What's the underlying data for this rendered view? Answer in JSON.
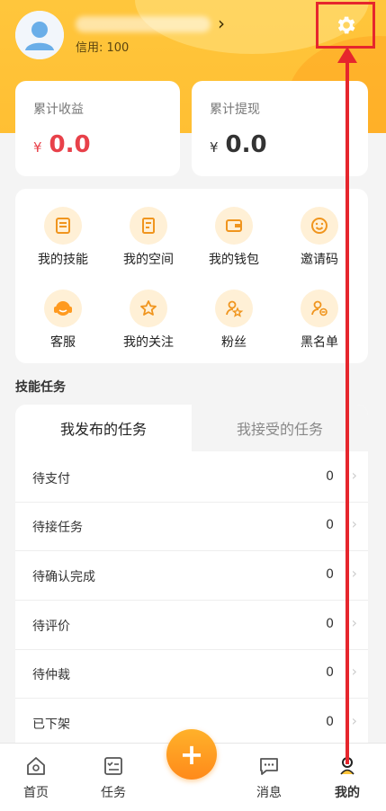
{
  "profile": {
    "credit_text": "信用: 100",
    "chevron": "›"
  },
  "settings": {
    "icon": "gear-icon"
  },
  "earnings": {
    "total_income_label": "累计收益",
    "total_income_currency": "¥",
    "total_income_value": "0.0",
    "total_withdraw_label": "累计提现",
    "total_withdraw_currency": "¥",
    "total_withdraw_value": "0.0",
    "income_color": "#e8414a",
    "withdraw_color": "#333333"
  },
  "shortcuts": [
    {
      "label": "我的技能",
      "icon": "skills-icon"
    },
    {
      "label": "我的空间",
      "icon": "space-icon"
    },
    {
      "label": "我的钱包",
      "icon": "wallet-icon"
    },
    {
      "label": "邀请码",
      "icon": "smile-icon"
    },
    {
      "label": "客服",
      "icon": "headset-icon"
    },
    {
      "label": "我的关注",
      "icon": "star-icon"
    },
    {
      "label": "粉丝",
      "icon": "fans-icon"
    },
    {
      "label": "黑名单",
      "icon": "blacklist-icon"
    }
  ],
  "tasks": {
    "section_title": "技能任务",
    "tab_published": "我发布的任务",
    "tab_accepted": "我接受的任务",
    "rows": [
      {
        "label": "待支付",
        "count": "0"
      },
      {
        "label": "待接任务",
        "count": "0"
      },
      {
        "label": "待确认完成",
        "count": "0"
      },
      {
        "label": "待评价",
        "count": "0"
      },
      {
        "label": "待仲裁",
        "count": "0"
      },
      {
        "label": "已下架",
        "count": "0"
      }
    ],
    "row_chevron": "›"
  },
  "bottom_nav": {
    "home": "首页",
    "tasks": "任务",
    "messages": "消息",
    "mine": "我的",
    "fab_symbol": "+"
  },
  "colors": {
    "accent": "#ffc63c",
    "orange": "#ff9a1f",
    "annotation_red": "#e6262d"
  }
}
